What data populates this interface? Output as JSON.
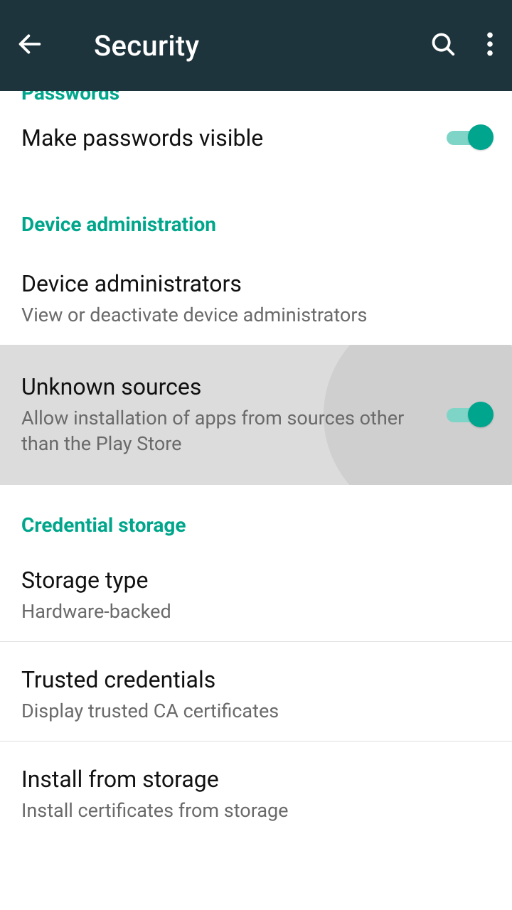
{
  "appbar": {
    "title": "Security"
  },
  "sections": {
    "passwords": {
      "header": "Passwords",
      "make_visible": {
        "title": "Make passwords visible",
        "on": true
      }
    },
    "device_admin": {
      "header": "Device administration",
      "device_admins": {
        "title": "Device administrators",
        "sub": "View or deactivate device administrators"
      },
      "unknown_sources": {
        "title": "Unknown sources",
        "sub": "Allow installation of apps from sources other than the Play Store",
        "on": true
      }
    },
    "cred_storage": {
      "header": "Credential storage",
      "storage_type": {
        "title": "Storage type",
        "sub": "Hardware-backed"
      },
      "trusted_creds": {
        "title": "Trusted credentials",
        "sub": "Display trusted CA certificates"
      },
      "install_from_storage": {
        "title": "Install from storage",
        "sub": "Install certificates from storage"
      }
    }
  },
  "colors": {
    "brand": "#1e343c",
    "accent": "#00a58e",
    "section_header": "#00a68b"
  }
}
